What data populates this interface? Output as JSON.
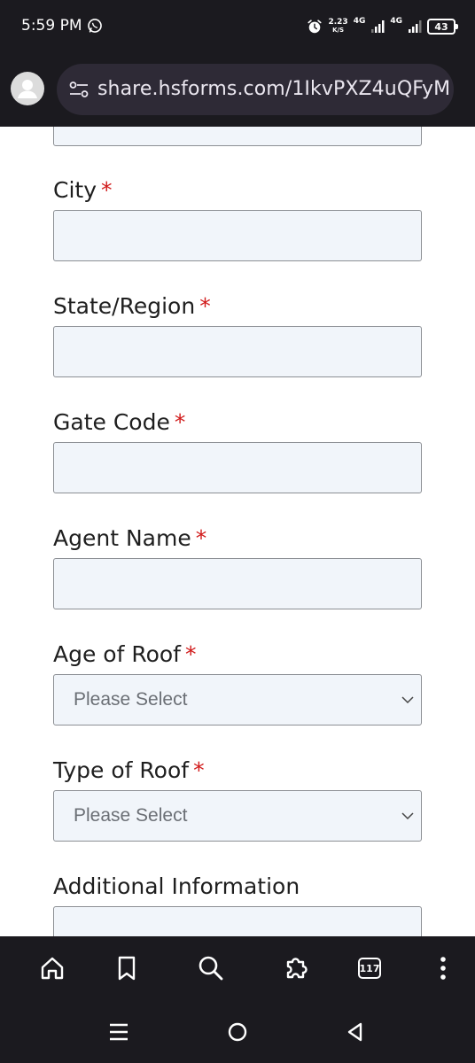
{
  "status_bar": {
    "time": "5:59 PM",
    "speed_value": "2.23",
    "speed_unit": "K/S",
    "network_1": "4G",
    "network_2": "4G",
    "battery": "43",
    "icons": [
      "whatsapp-icon",
      "alarm-icon",
      "signal-icon",
      "battery-icon"
    ]
  },
  "browser": {
    "url": "share.hsforms.com/1IkvPXZ4uQFyM",
    "icons": [
      "profile-avatar",
      "tune-icon"
    ]
  },
  "form": {
    "fields": [
      {
        "label": "City",
        "required_mark": "*"
      },
      {
        "label": "State/Region",
        "required_mark": "*"
      },
      {
        "label": "Gate Code",
        "required_mark": "*"
      },
      {
        "label": "Agent Name",
        "required_mark": "*"
      },
      {
        "label": "Age of Roof",
        "required_mark": "*",
        "value": "Please Select"
      },
      {
        "label": "Type of Roof",
        "required_mark": "*",
        "value": "Please Select"
      },
      {
        "label": "Additional Information"
      }
    ],
    "colors": {
      "required": "#d11a1a",
      "input_bg": "#f1f5fa",
      "input_border": "#8c8f94"
    }
  },
  "toolbar": {
    "tab_count": "117",
    "icons": [
      "home-icon",
      "bookmark-icon",
      "search-icon",
      "extensions-icon",
      "tabs-icon",
      "more-icon"
    ]
  },
  "nav": {
    "icons": [
      "recents-icon",
      "home-circle-icon",
      "back-icon"
    ]
  }
}
